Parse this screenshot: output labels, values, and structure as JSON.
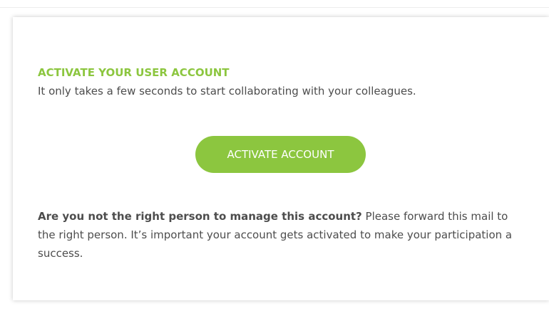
{
  "email": {
    "heading": "ACTIVATE YOUR USER ACCOUNT",
    "subtext": "It only takes a few seconds to start collaborating with your colleagues.",
    "button_label": "ACTIVATE ACCOUNT",
    "note_bold": "Are you not the right person to manage this account?",
    "note_text": " Please forward this mail to the right person. It’s important your account gets activated to make your participation a success."
  },
  "colors": {
    "accent": "#8cc63f",
    "text": "#4d4d4d",
    "background": "#ffffff"
  }
}
